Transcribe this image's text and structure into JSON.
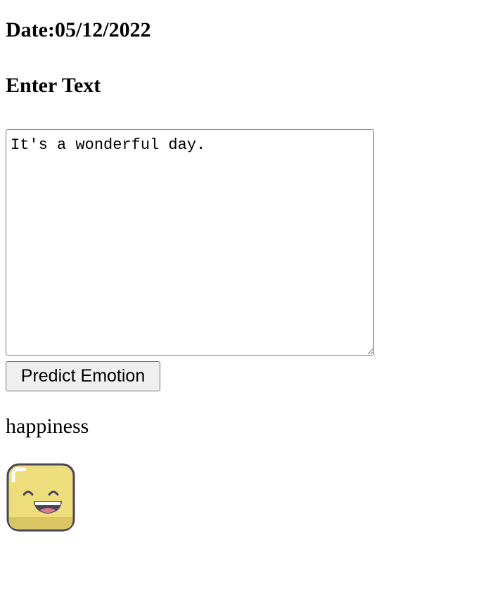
{
  "header": {
    "date_text": "Date:05/12/2022",
    "prompt_label": "Enter Text"
  },
  "input": {
    "value": "It's a wonderful day."
  },
  "actions": {
    "predict_label": "Predict Emotion"
  },
  "result": {
    "emotion_label": "happiness",
    "emoji_icon": "grinning-face-icon",
    "emoji_color": "#EDDD7B",
    "emoji_outline_color": "#4A4459",
    "emoji_mouth_color": "#DA7A8F"
  }
}
